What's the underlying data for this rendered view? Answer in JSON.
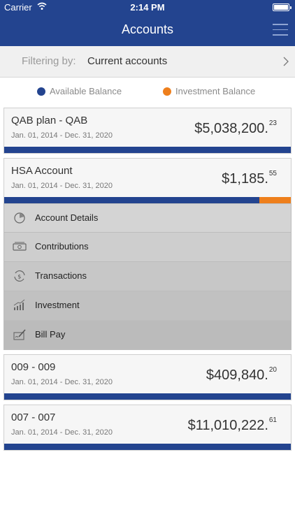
{
  "status_bar": {
    "carrier": "Carrier",
    "time": "2:14 PM"
  },
  "nav": {
    "title": "Accounts",
    "menu_icon": "hamburger-menu-icon"
  },
  "filter": {
    "label": "Filtering by:",
    "value": "Current accounts"
  },
  "legend": {
    "available": {
      "label": "Available Balance",
      "color": "#23448f"
    },
    "investment": {
      "label": "Investment Balance",
      "color": "#ee7f1c"
    }
  },
  "accounts": [
    {
      "name": "QAB plan - QAB",
      "dates": "Jan. 01, 2014 - Dec. 31, 2020",
      "amount_main": "$5,038,200.",
      "amount_cents": "23",
      "investment_fraction": 0
    },
    {
      "name": "HSA Account",
      "dates": "Jan. 01, 2014 - Dec. 31, 2020",
      "amount_main": "$1,185.",
      "amount_cents": "55",
      "investment_fraction": 0.11
    },
    {
      "name": "009 - 009",
      "dates": "Jan. 01, 2014 - Dec. 31, 2020",
      "amount_main": "$409,840.",
      "amount_cents": "20",
      "investment_fraction": 0
    },
    {
      "name": "007 - 007",
      "dates": "Jan. 01, 2014 - Dec. 31, 2020",
      "amount_main": "$11,010,222.",
      "amount_cents": "61",
      "investment_fraction": 0
    }
  ],
  "account_menu": [
    {
      "label": "Account Details",
      "icon": "pie-chart-icon"
    },
    {
      "label": "Contributions",
      "icon": "cash-icon"
    },
    {
      "label": "Transactions",
      "icon": "dollar-cycle-icon"
    },
    {
      "label": "Investment",
      "icon": "growth-chart-icon"
    },
    {
      "label": "Bill Pay",
      "icon": "check-sign-icon"
    }
  ]
}
